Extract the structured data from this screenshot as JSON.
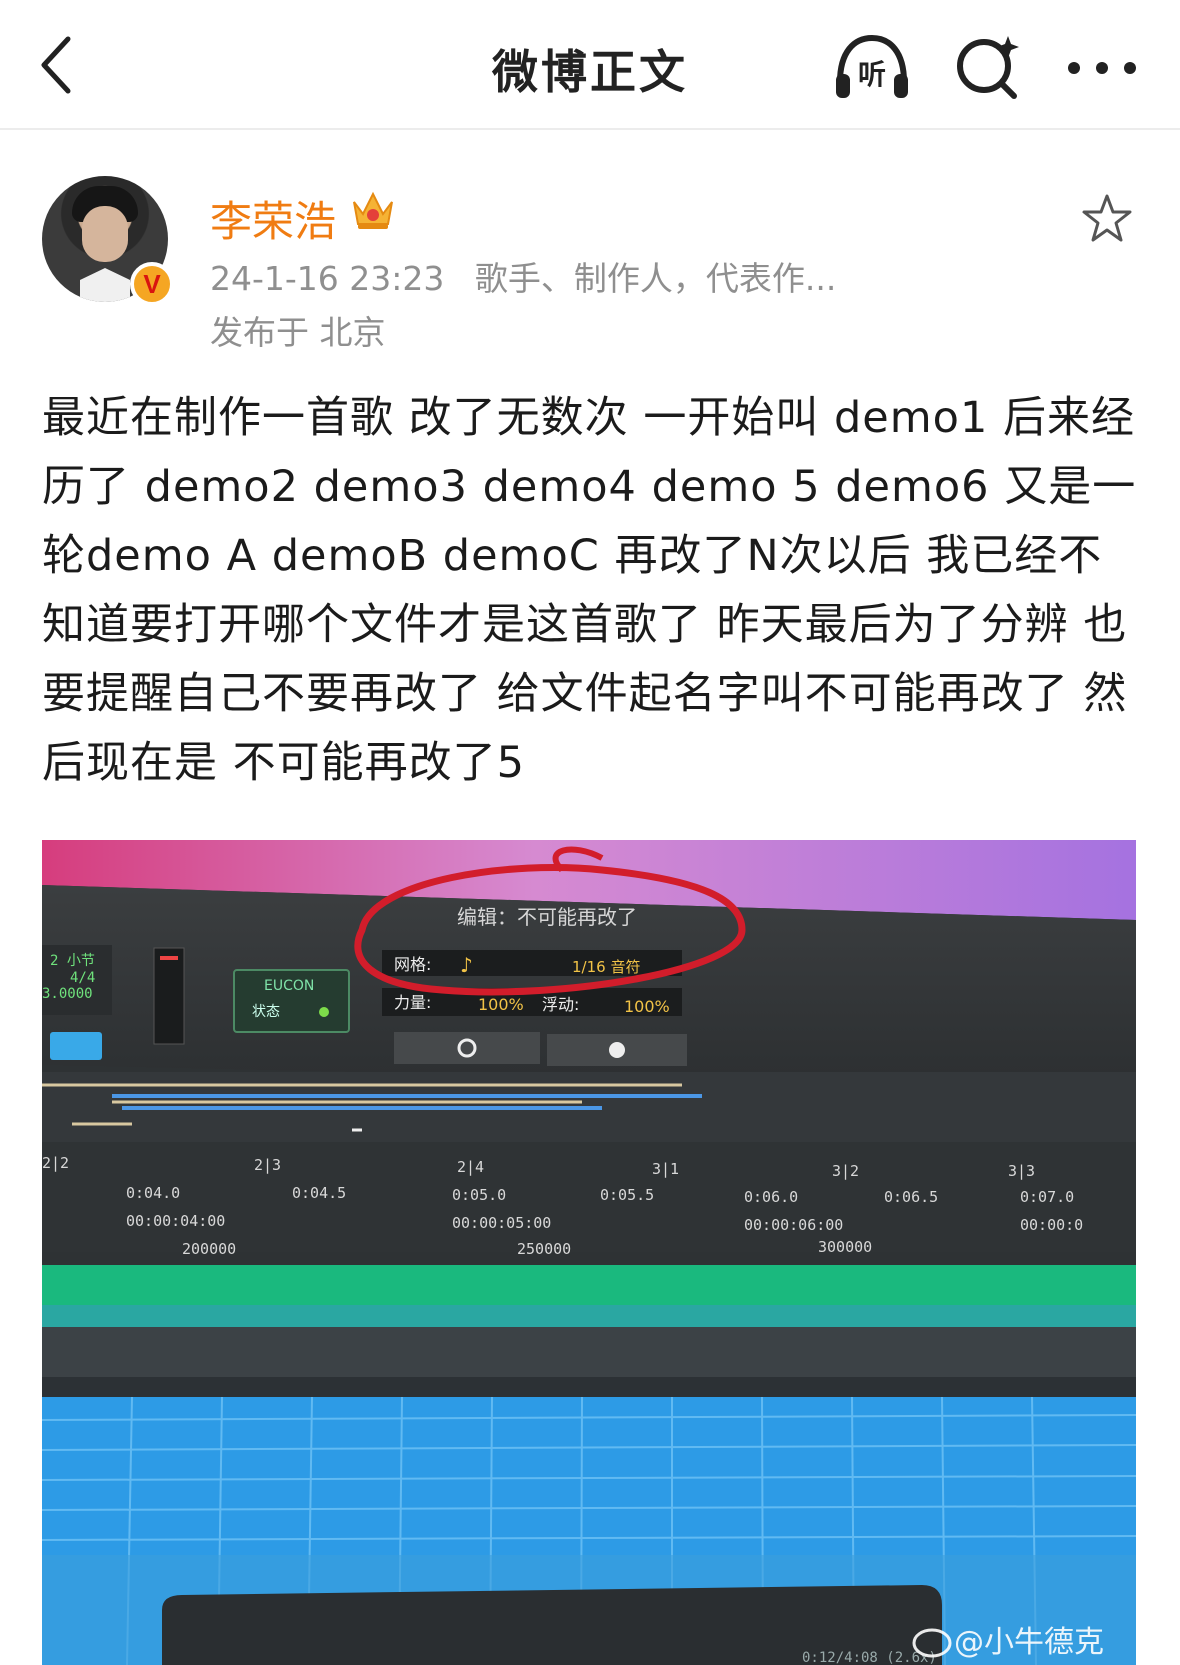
{
  "nav": {
    "title": "微博正文",
    "listen_label": "听"
  },
  "author": {
    "name": "李荣浩",
    "time": "24-1-16 23:23",
    "bio": "歌手、制作人，代表作...",
    "location": "发布于 北京",
    "verified_mark": "V"
  },
  "post": {
    "text": "最近在制作一首歌 改了无数次 一开始叫 demo1 后来经历了 demo2 demo3 demo4 demo 5 demo6 又是一轮demo A demoB demoC 再改了N次以后 我已经不知道要打开哪个文件才是这首歌了 昨天最后为了分辨 也要提醒自己不要再改了 给文件起名字叫不可能再改了 然后现在是 不可能再改了5"
  },
  "photo": {
    "window_title": "编辑：不可能再改了",
    "grid_label": "网格:",
    "grid_value": "1/16 音符",
    "strength_label": "力量:",
    "strength_value": "100%",
    "float_label": "浮动:",
    "float_value": "100%",
    "eucon_label": "EUCON",
    "status_label": "状态",
    "bars_label": "2 小节",
    "meter": "4/4",
    "tempo": "3.0000",
    "ruler_bars": [
      "2|2",
      "2|3",
      "2|4",
      "3|1",
      "3|2",
      "3|3"
    ],
    "ruler_seconds": [
      "0:04.0",
      "0:04.5",
      "0:05.0",
      "0:05.5",
      "0:06.0",
      "0:06.5",
      "0:07.0"
    ],
    "ruler_timecode": [
      "00:00:04:00",
      "00:00:05:00",
      "00:00:06:00",
      "00:00:0"
    ],
    "ruler_samples": [
      "200000",
      "250000",
      "300000"
    ],
    "bottom_readout": "0:12/4:08 (2.6x)",
    "watermark": "@小牛德克",
    "colors": {
      "circle": "#d21d2b",
      "grid_blue": "#2d9be6",
      "track_green": "#1ab97e"
    }
  }
}
